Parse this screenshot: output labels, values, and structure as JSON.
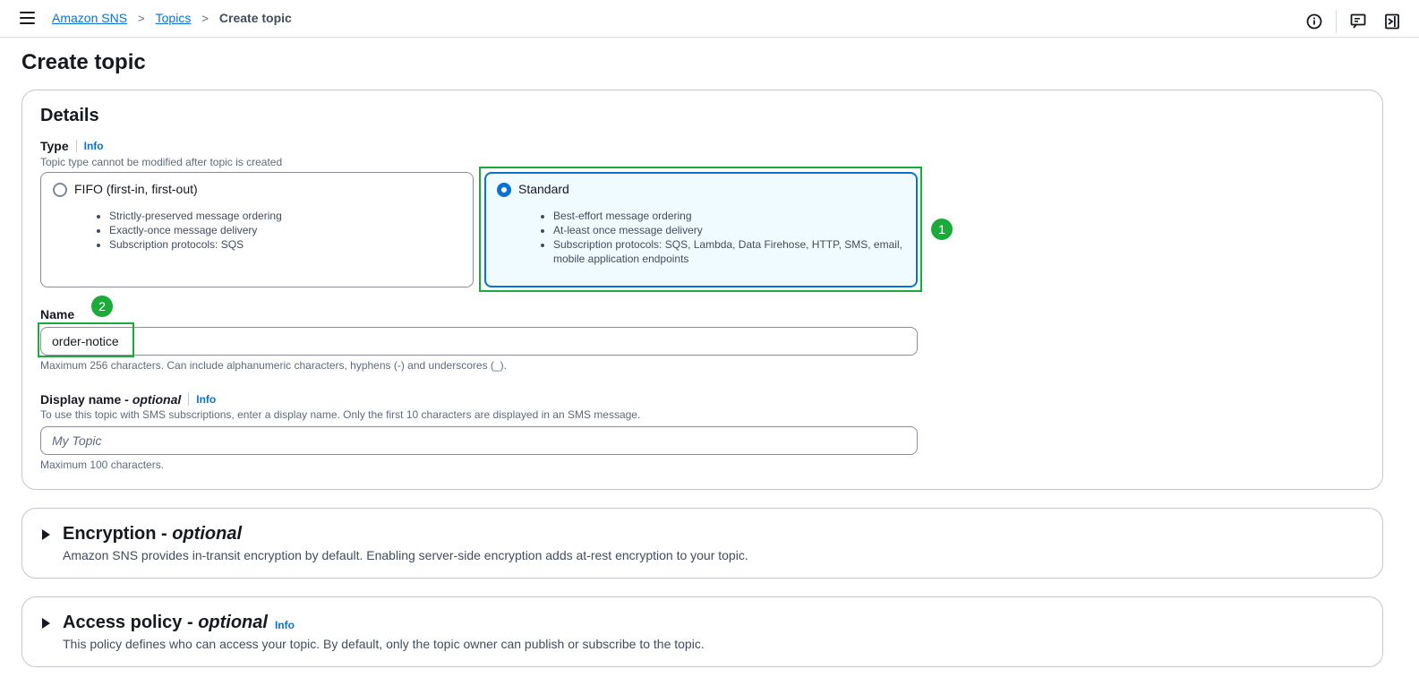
{
  "breadcrumb": {
    "items": [
      "Amazon SNS",
      "Topics"
    ],
    "current": "Create topic",
    "separator": ">"
  },
  "header_icons": [
    "info-circle-icon",
    "feedback-icon",
    "panel-toggle-icon"
  ],
  "page_title": "Create topic",
  "details": {
    "title": "Details",
    "type_label": "Type",
    "type_info": "Info",
    "type_desc": "Topic type cannot be modified after topic is created",
    "options": [
      {
        "title": "FIFO (first-in, first-out)",
        "selected": false,
        "bullets": [
          "Strictly-preserved message ordering",
          "Exactly-once message delivery",
          "Subscription protocols: SQS"
        ]
      },
      {
        "title": "Standard",
        "selected": true,
        "bullets": [
          "Best-effort message ordering",
          "At-least once message delivery",
          "Subscription protocols: SQS, Lambda, Data Firehose, HTTP, SMS, email, mobile application endpoints"
        ]
      }
    ],
    "name_label": "Name",
    "name_value": "order-notice",
    "name_hint": "Maximum 256 characters. Can include alphanumeric characters, hyphens (-) and underscores (_).",
    "display_label": "Display name - ",
    "display_label_optional": "optional",
    "display_info": "Info",
    "display_desc": "To use this topic with SMS subscriptions, enter a display name. Only the first 10 characters are displayed in an SMS message.",
    "display_placeholder": "My Topic",
    "display_hint": "Maximum 100 characters."
  },
  "annotations": [
    "1",
    "2"
  ],
  "encryption": {
    "title": "Encryption - ",
    "title_optional": "optional",
    "desc": "Amazon SNS provides in-transit encryption by default. Enabling server-side encryption adds at-rest encryption to your topic."
  },
  "access_policy": {
    "title": "Access policy - ",
    "title_optional": "optional",
    "info": "Info",
    "desc": "This policy defines who can access your topic. By default, only the topic owner can publish or subscribe to the topic."
  },
  "colors": {
    "link": "#0972d3",
    "annotation_green": "#1aab3a",
    "selected_tile_bg": "#f0fbff"
  }
}
